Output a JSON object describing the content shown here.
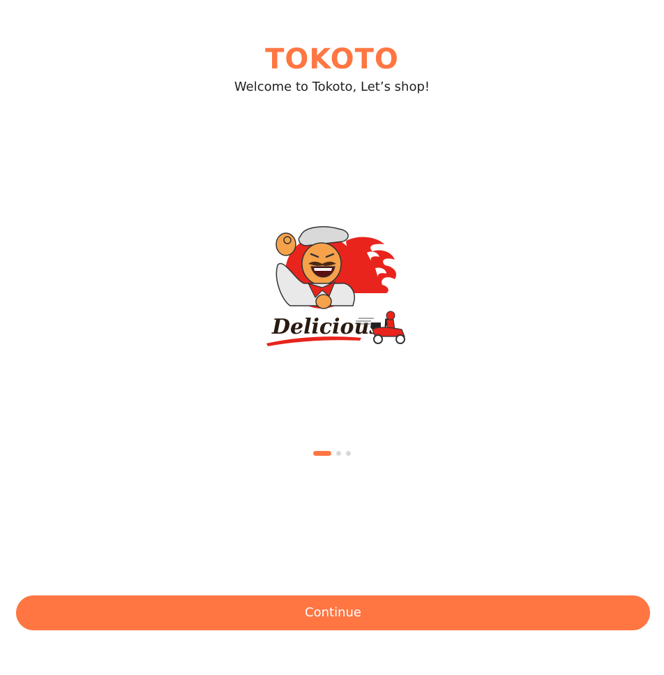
{
  "splash": {
    "brand_title": "TOKOTO",
    "tagline": "Welcome to Tokoto, Let’s shop!",
    "illustration_text": "Delicious!"
  },
  "pagination": {
    "current_page": 1,
    "total_pages": 3
  },
  "actions": {
    "continue_label": "Continue"
  },
  "colors": {
    "primary": "#FF7643",
    "inactive_dot": "#D8D8D8",
    "text": "#1f1f1f",
    "background": "#FFFFFF"
  }
}
